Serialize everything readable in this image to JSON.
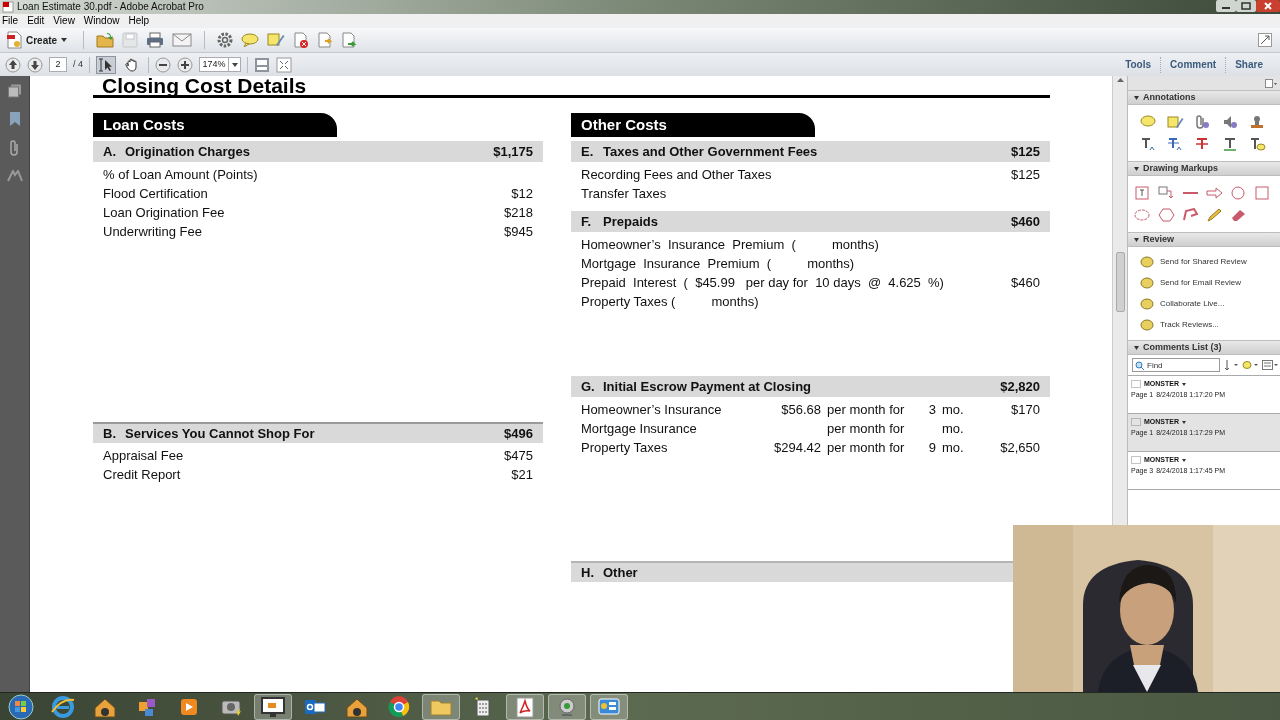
{
  "window": {
    "title": "Loan Estimate 30.pdf - Adobe Acrobat Pro"
  },
  "menu": [
    "File",
    "Edit",
    "View",
    "Window",
    "Help"
  ],
  "toolbar": {
    "create_label": "Create",
    "save_disabled": true,
    "page_number": "2",
    "page_count": "/ 4",
    "zoom": "174%",
    "tools": [
      {
        "kind": "select",
        "selected": true
      },
      {
        "kind": "hand",
        "selected": false
      }
    ]
  },
  "panel_tabs": [
    "Tools",
    "Comment",
    "Share"
  ],
  "document": {
    "heading": "Closing Cost Details",
    "columns": [
      {
        "title": "Loan Costs",
        "sections": [
          {
            "letter": "A.",
            "title": "Origination Charges",
            "amount": "$1,175",
            "kind": "simple",
            "rows": [
              {
                "label": "% of Loan Amount (Points)"
              },
              {
                "label": "Flood Certification",
                "amount": "$12"
              },
              {
                "label": "Loan Origination Fee",
                "amount": "$218"
              },
              {
                "label": "Underwriting Fee",
                "amount": "$945"
              }
            ]
          },
          {
            "letter": "B.",
            "title": "Services You Cannot Shop For",
            "amount": "$496",
            "kind": "simple",
            "rows": [
              {
                "label": "Appraisal Fee",
                "amount": "$475"
              },
              {
                "label": "Credit Report",
                "amount": "$21"
              }
            ]
          }
        ]
      },
      {
        "title": "Other Costs",
        "sections": [
          {
            "letter": "E.",
            "title": "Taxes and Other Government Fees",
            "amount": "$125",
            "kind": "simple",
            "rows": [
              {
                "label": "Recording Fees and Other Taxes",
                "amount": "$125"
              },
              {
                "label": "Transfer Taxes"
              }
            ]
          },
          {
            "letter": "F.",
            "title": "Prepaids",
            "amount": "$460",
            "kind": "simple",
            "rows": [
              {
                "label": "Homeowner’s  Insurance  Premium  (          months)"
              },
              {
                "label": "Mortgage  Insurance  Premium  (          months)"
              },
              {
                "label": "Prepaid  Interest  (  $45.99   per day for  10 days  @  4.625  %)",
                "amount": "$460"
              },
              {
                "label": "Property Taxes (          months)"
              }
            ]
          },
          {
            "letter": "G.",
            "title": "Initial Escrow Payment at Closing",
            "amount": "$2,820",
            "kind": "escrow",
            "rows": [
              {
                "label": "Homeowner’s Insurance",
                "rate": "$56.68",
                "per": "per month for",
                "months": "3",
                "unit": "mo.",
                "amount": "$170"
              },
              {
                "label": "Mortgage Insurance",
                "per": "per month for",
                "unit": "mo."
              },
              {
                "label": "Property Taxes",
                "rate": "$294.42",
                "per": "per month for",
                "months": "9",
                "unit": "mo.",
                "amount": "$2,650"
              }
            ]
          },
          {
            "letter": "H.",
            "title": "Other"
          }
        ]
      }
    ]
  },
  "side_panel": {
    "annotations_title": "Annotations",
    "drawing_title": "Drawing Markups",
    "review": {
      "title": "Review",
      "items": [
        "Send for Shared Review",
        "Send for Email Review",
        "Collaborate Live...",
        "Track Reviews..."
      ]
    },
    "comments": {
      "title": "Comments List (3)",
      "search_placeholder": "Find",
      "items": [
        {
          "author": "MONSTER",
          "page": "Page 1",
          "time": "8/24/2018 1:17:20 PM",
          "selected": false
        },
        {
          "author": "MONSTER",
          "page": "Page 1",
          "time": "8/24/2018 1:17:29 PM",
          "selected": true
        },
        {
          "author": "MONSTER",
          "page": "Page 3",
          "time": "8/24/2018 1:17:45 PM",
          "selected": false
        }
      ]
    }
  },
  "webcam": {
    "kind": "picture"
  }
}
